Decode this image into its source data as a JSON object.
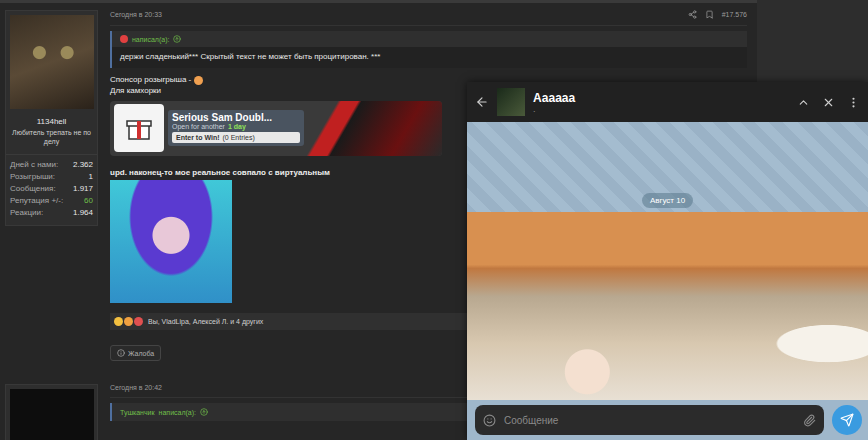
{
  "post": {
    "user": {
      "name": "1134hell",
      "title": "Любитель трепать не по делу",
      "stats": [
        {
          "label": "Дней с нами:",
          "value": "2.362",
          "color": "#e6e6e6"
        },
        {
          "label": "Розыгрыши:",
          "value": "1",
          "color": "#e6e6e6"
        },
        {
          "label": "Сообщения:",
          "value": "1.917",
          "color": "#e6e6e6"
        },
        {
          "label": "Репутация +/-:",
          "value": "60",
          "color": "#6fbf4a"
        },
        {
          "label": "Реакции:",
          "value": "1.964",
          "color": "#e6e6e6"
        }
      ]
    },
    "time": "Сегодня в 20:33",
    "number": "#17.576",
    "quote": {
      "action": "написал(а):",
      "text": "держи сладенький*** Скрытый текст не может быть процитирован. ***"
    },
    "lines": [
      "Спонсор розыгрыша -",
      "Для камхорки"
    ],
    "giveaway": {
      "title": "Serious Sam Doubl...",
      "open_label": "Open for another",
      "open_value": "1 day",
      "button": "Enter to Win!",
      "entries": "(0 Entries)"
    },
    "update": "upd. наконец-то мое реальное совпало с виртуальным",
    "reactions": "Вы, VladLipa, Алексей Л. и 4 других",
    "report": "Жалоба"
  },
  "next_post": {
    "time": "Сегодня в 20:42",
    "quote": {
      "author": "Тушканчик",
      "action": "написал(а):"
    }
  },
  "chat": {
    "title": "Аааааа",
    "subtitle": ".",
    "date": "Август 10",
    "input_placeholder": "Сообщение"
  }
}
